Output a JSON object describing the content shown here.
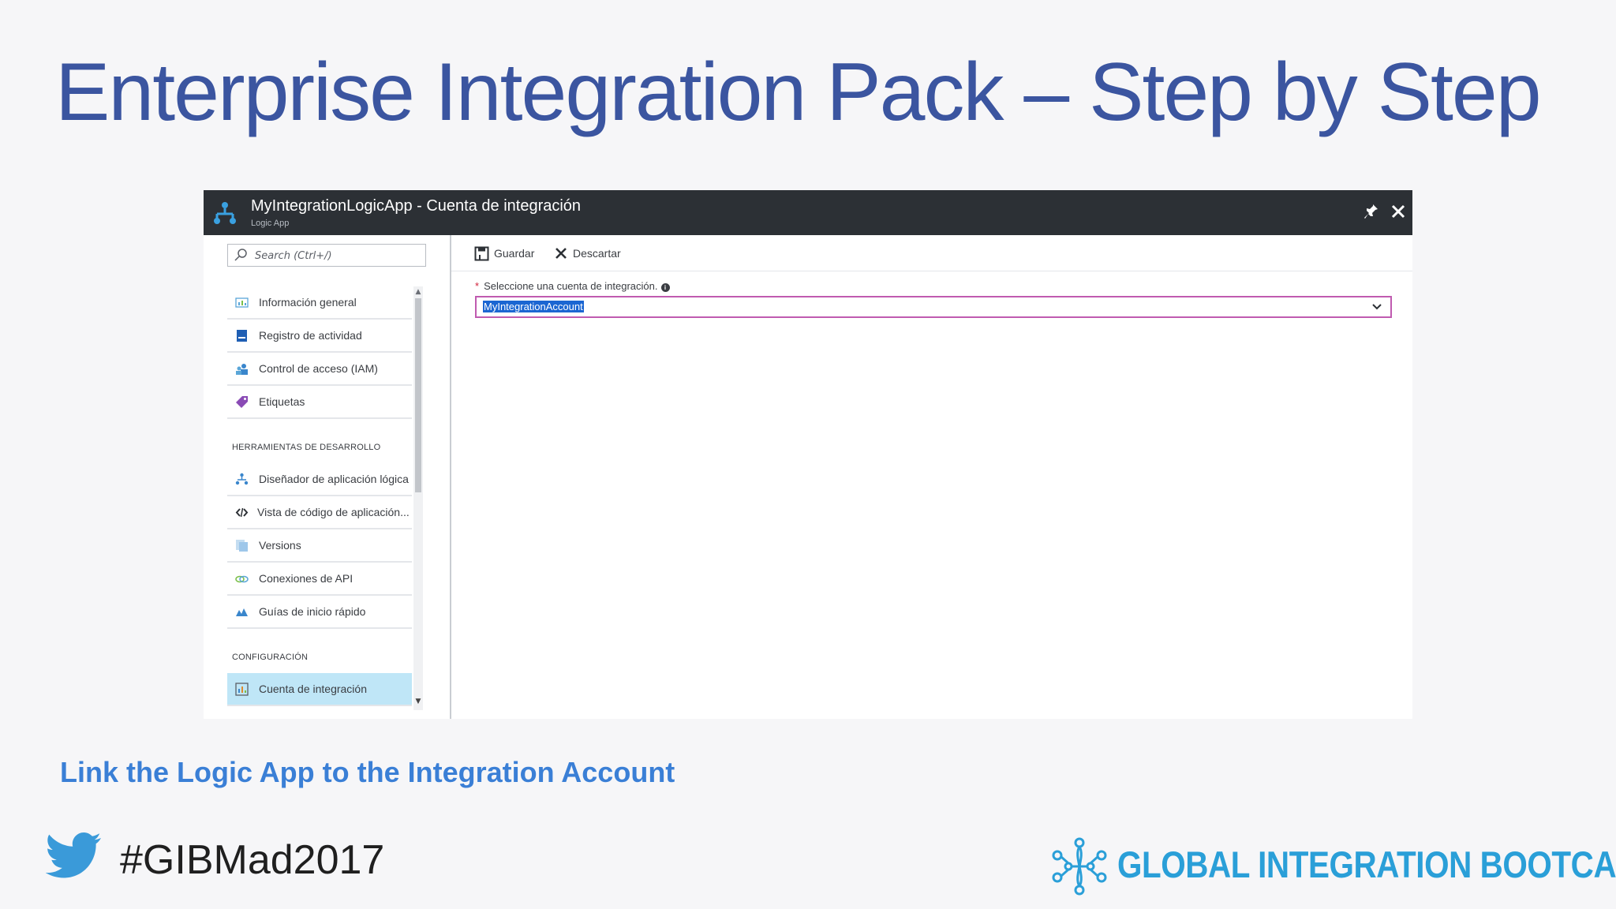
{
  "slide": {
    "title": "Enterprise Integration Pack – Step by Step",
    "caption": "Link the Logic App to the Integration Account",
    "hashtag": "#GIBMad2017",
    "brand": "GLOBAL INTEGRATION BOOTCAMP"
  },
  "portal": {
    "title": "MyIntegrationLogicApp - Cuenta de integración",
    "subtitle": "Logic App",
    "search": {
      "placeholder": "Search (Ctrl+/)"
    },
    "toolbar": {
      "save_label": "Guardar",
      "discard_label": "Descartar"
    },
    "nav": {
      "items_top": [
        {
          "label": "Información general",
          "icon": "overview-icon"
        },
        {
          "label": "Registro de actividad",
          "icon": "activity-log-icon"
        },
        {
          "label": "Control de acceso (IAM)",
          "icon": "users-icon"
        },
        {
          "label": "Etiquetas",
          "icon": "tag-icon"
        }
      ],
      "section_dev": "HERRAMIENTAS DE DESARROLLO",
      "items_dev": [
        {
          "label": "Diseñador de aplicación lógica",
          "icon": "logic-app-designer-icon"
        },
        {
          "label": "Vista de código de aplicación...",
          "icon": "code-icon"
        },
        {
          "label": "Versions",
          "icon": "versions-icon"
        },
        {
          "label": "Conexiones de API",
          "icon": "api-connections-icon"
        },
        {
          "label": "Guías de inicio rápido",
          "icon": "quickstart-icon"
        }
      ],
      "section_config": "CONFIGURACIÓN",
      "items_config": [
        {
          "label": "Cuenta de integración",
          "icon": "integration-account-icon",
          "active": true
        }
      ]
    },
    "form": {
      "label": "Seleccione una cuenta de integración.",
      "selected_value": "MyIntegrationAccount"
    }
  },
  "colors": {
    "title": "#3b55a0",
    "caption": "#3a7fd6",
    "brand": "#2a9fd8",
    "header": "#2c3035",
    "active_nav": "#bfe6f7",
    "select_border": "#c05bb0"
  }
}
